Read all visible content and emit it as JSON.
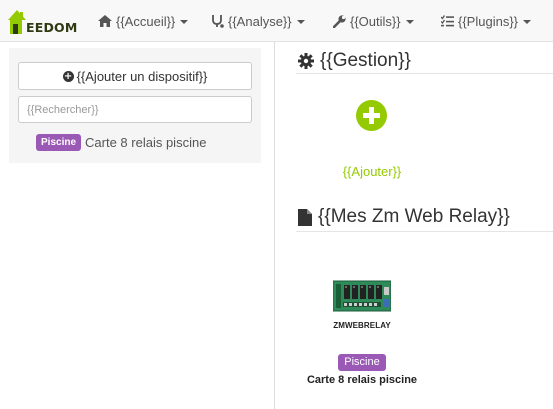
{
  "colors": {
    "accent": "#94ca02",
    "badge": "#9b59b6",
    "navbar_bg": "#f8f8f8",
    "panel_bg": "#f5f5f5"
  },
  "navbar": {
    "logo_text": "EEDOM",
    "menus": [
      {
        "label": "{{Accueil}}",
        "icon": "home-icon"
      },
      {
        "label": "{{Analyse}}",
        "icon": "stethoscope-icon"
      },
      {
        "label": "{{Outils}}",
        "icon": "wrench-icon"
      },
      {
        "label": "{{Plugins}}",
        "icon": "tasks-icon"
      }
    ]
  },
  "sidebar": {
    "add_button_label": "{{Ajouter un dispositif}}",
    "search_placeholder": "{{Rechercher}}",
    "equipments": [
      {
        "badge": "Piscine",
        "name": "Carte 8 relais piscine"
      }
    ]
  },
  "management": {
    "title": "{{Gestion}}",
    "add_label": "{{Ajouter}}"
  },
  "devices": {
    "title": "{{Mes Zm Web Relay}}",
    "items": [
      {
        "caption": "ZMWEBRELAY",
        "badge": "Piscine",
        "name": "Carte 8 relais piscine"
      }
    ]
  }
}
